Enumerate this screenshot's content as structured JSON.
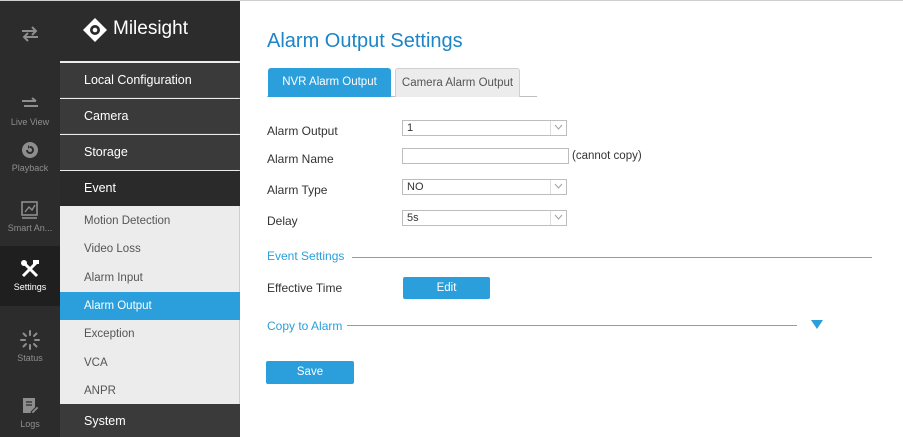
{
  "brand": {
    "name": "Milesight"
  },
  "rail": [
    {
      "icon": "swap-arrows-icon",
      "label": ""
    },
    {
      "icon": "live-view-icon",
      "label": "Live View"
    },
    {
      "icon": "playback-icon",
      "label": "Playback"
    },
    {
      "icon": "smart-analysis-icon",
      "label": "Smart An..."
    },
    {
      "icon": "settings-tools-icon",
      "label": "Settings",
      "active": true
    },
    {
      "icon": "status-spinner-icon",
      "label": "Status"
    },
    {
      "icon": "logs-icon",
      "label": "Logs"
    }
  ],
  "menu": {
    "local_configuration": "Local Configuration",
    "camera": "Camera",
    "storage": "Storage",
    "event": "Event",
    "event_items": [
      "Motion Detection",
      "Video Loss",
      "Alarm Input",
      "Alarm Output",
      "Exception",
      "VCA",
      "ANPR"
    ],
    "active_item": "Alarm Output",
    "system": "System"
  },
  "page": {
    "title": "Alarm Output Settings",
    "tabs": [
      {
        "label": "NVR Alarm Output",
        "active": true
      },
      {
        "label": "Camera Alarm Output",
        "active": false
      }
    ]
  },
  "form": {
    "alarm_output": {
      "label": "Alarm Output",
      "value": "1"
    },
    "alarm_name": {
      "label": "Alarm Name",
      "value": "",
      "note": "(cannot copy)"
    },
    "alarm_type": {
      "label": "Alarm Type",
      "value": "NO"
    },
    "delay": {
      "label": "Delay",
      "value": "5s"
    }
  },
  "event_settings": {
    "title": "Event Settings",
    "effective_time_label": "Effective Time",
    "edit_label": "Edit"
  },
  "copy_to_alarm": {
    "title": "Copy to Alarm"
  },
  "save_label": "Save",
  "colors": {
    "accent": "#2a9fdc",
    "title": "#1b85c8",
    "rail_bg": "#2c2c2c",
    "menu_bg": "#ececec"
  }
}
